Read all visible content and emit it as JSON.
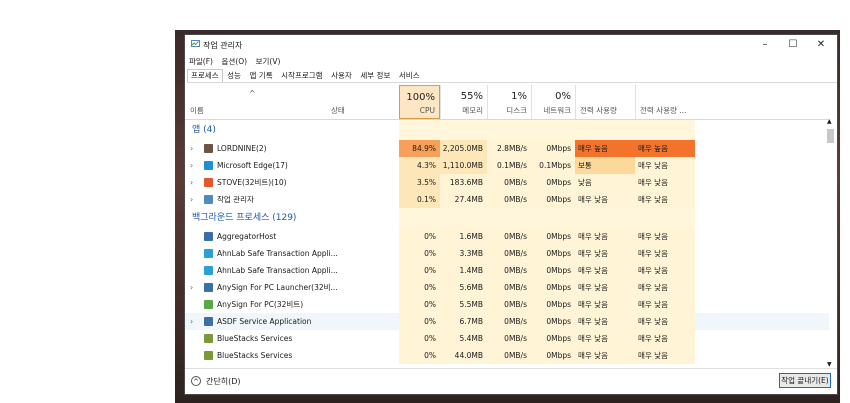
{
  "window": {
    "title": "작업 관리자",
    "controls": {
      "minimize": "–",
      "maximize": "☐",
      "close": "✕"
    }
  },
  "menu": [
    "파일(F)",
    "옵션(O)",
    "보기(V)"
  ],
  "tabs": [
    "프로세스",
    "성능",
    "앱 기록",
    "시작프로그램",
    "사용자",
    "세부 정보",
    "서비스"
  ],
  "header": {
    "name": "이름",
    "status": "상태",
    "cpu": {
      "pct": "100%",
      "label": "CPU"
    },
    "memory": {
      "pct": "55%",
      "label": "메모리"
    },
    "disk": {
      "pct": "1%",
      "label": "디스크"
    },
    "network": {
      "pct": "0%",
      "label": "네트워크"
    },
    "power": "전력 사용량",
    "power_trend": "전력 사용량 ..."
  },
  "groups": {
    "apps": "앱 (4)",
    "background": "백그라운드 프로세스 (129)"
  },
  "apps": [
    {
      "name": "LORDNINE(2)",
      "cpu": "84.9%",
      "mem": "2,205.0MB",
      "disk": "2.8MB/s",
      "net": "0Mbps",
      "power": "매우 높음",
      "trend": "매우 높음",
      "icon_color": "#6b5540"
    },
    {
      "name": "Microsoft Edge(17)",
      "cpu": "4.3%",
      "mem": "1,110.0MB",
      "disk": "0.1MB/s",
      "net": "0.1Mbps",
      "power": "보통",
      "trend": "매우 낮음",
      "icon_color": "#1c8fd8"
    },
    {
      "name": "STOVE(32비트)(10)",
      "cpu": "3.5%",
      "mem": "183.6MB",
      "disk": "0MB/s",
      "net": "0Mbps",
      "power": "낮음",
      "trend": "매우 낮음",
      "icon_color": "#e4572e"
    },
    {
      "name": "작업 관리자",
      "cpu": "0.1%",
      "mem": "27.4MB",
      "disk": "0MB/s",
      "net": "0Mbps",
      "power": "매우 낮음",
      "trend": "매우 낮음",
      "icon_color": "#4f8bbd"
    }
  ],
  "background": [
    {
      "name": "AggregatorHost",
      "cpu": "0%",
      "mem": "1.6MB",
      "disk": "0MB/s",
      "net": "0Mbps",
      "power": "매우 낮음",
      "trend": "매우 낮음",
      "icon_color": "#3a6fa8"
    },
    {
      "name": "AhnLab Safe Transaction Appli...",
      "cpu": "0%",
      "mem": "3.3MB",
      "disk": "0MB/s",
      "net": "0Mbps",
      "power": "매우 낮음",
      "trend": "매우 낮음",
      "icon_color": "#2ba0d8"
    },
    {
      "name": "AhnLab Safe Transaction Appli...",
      "cpu": "0%",
      "mem": "1.4MB",
      "disk": "0MB/s",
      "net": "0Mbps",
      "power": "매우 낮음",
      "trend": "매우 낮음",
      "icon_color": "#2ba0d8"
    },
    {
      "name": "AnySign For PC Launcher(32비...",
      "cpu": "0%",
      "mem": "5.6MB",
      "disk": "0MB/s",
      "net": "0Mbps",
      "power": "매우 낮음",
      "trend": "매우 낮음",
      "icon_color": "#3a6fa8"
    },
    {
      "name": "AnySign For PC(32비트)",
      "cpu": "0%",
      "mem": "5.5MB",
      "disk": "0MB/s",
      "net": "0Mbps",
      "power": "매우 낮음",
      "trend": "매우 낮음",
      "icon_color": "#58a84a"
    },
    {
      "name": "ASDF Service Application",
      "cpu": "0%",
      "mem": "6.7MB",
      "disk": "0MB/s",
      "net": "0Mbps",
      "power": "매우 낮음",
      "trend": "매우 낮음",
      "icon_color": "#3a6fa8"
    },
    {
      "name": "BlueStacks Services",
      "cpu": "0%",
      "mem": "5.4MB",
      "disk": "0MB/s",
      "net": "0Mbps",
      "power": "매우 낮음",
      "trend": "매우 낮음",
      "icon_color": "#7a9a3a"
    },
    {
      "name": "BlueStacks Services",
      "cpu": "0%",
      "mem": "44.0MB",
      "disk": "0MB/s",
      "net": "0Mbps",
      "power": "매우 낮음",
      "trend": "매우 낮음",
      "icon_color": "#7a9a3a"
    }
  ],
  "footer": {
    "fewer_details": "간단히(D)",
    "end_task": "작업 끝내기(E)"
  },
  "colors": {
    "cpu_high": "#f7a05a",
    "power_very_high": "#f4732a",
    "power_normal": "#fcd89a",
    "heat_light": "#fff4d6",
    "heat_mid": "#fde7b8",
    "accent": "#1c69c4"
  }
}
